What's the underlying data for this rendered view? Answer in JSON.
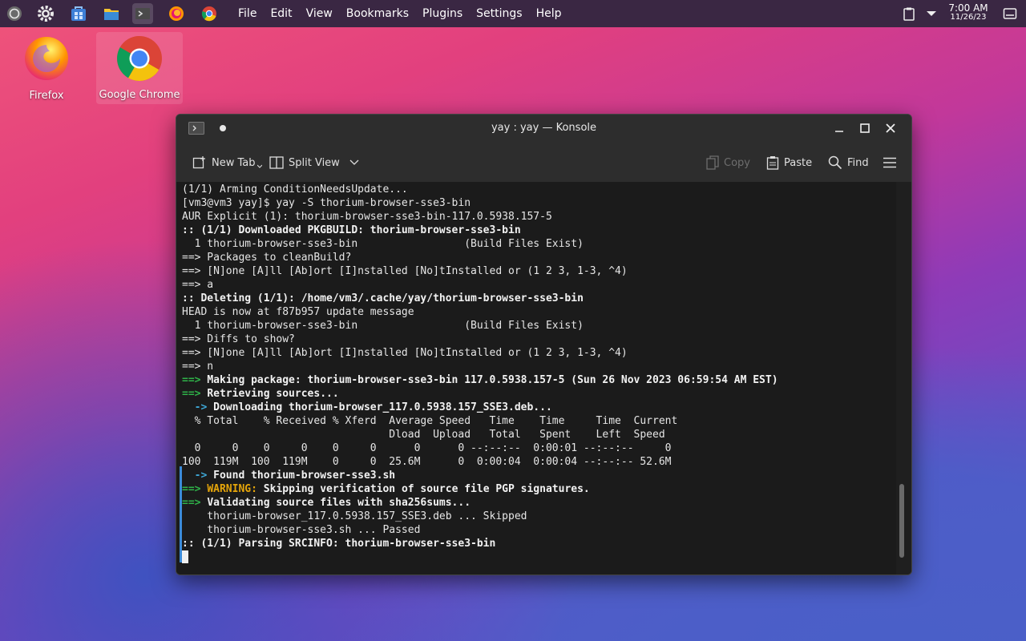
{
  "taskbar": {
    "menu": [
      "File",
      "Edit",
      "View",
      "Bookmarks",
      "Plugins",
      "Settings",
      "Help"
    ],
    "clock": {
      "time": "7:00 AM",
      "date": "11/26/23"
    }
  },
  "desktop": {
    "icons": [
      {
        "label": "Firefox"
      },
      {
        "label": "Google Chrome"
      }
    ]
  },
  "window": {
    "title": "yay : yay — Konsole",
    "toolbar": {
      "new_tab": "New Tab",
      "split_view": "Split View",
      "copy": "Copy",
      "paste": "Paste",
      "find": "Find"
    }
  },
  "terminal": {
    "lines": [
      {
        "segments": [
          {
            "text": "(1/1) Arming ConditionNeedsUpdate...",
            "style": ""
          }
        ]
      },
      {
        "segments": [
          {
            "text": "[vm3@vm3 yay]$ yay -S thorium-browser-sse3-bin",
            "style": ""
          }
        ]
      },
      {
        "segments": [
          {
            "text": "AUR Explicit (1): thorium-browser-sse3-bin-117.0.5938.157-5",
            "style": ""
          }
        ]
      },
      {
        "segments": [
          {
            "text": ":: (1/1) Downloaded PKGBUILD: thorium-browser-sse3-bin",
            "style": "b"
          }
        ]
      },
      {
        "segments": [
          {
            "text": "  1 thorium-browser-sse3-bin                 (Build Files Exist)",
            "style": ""
          }
        ]
      },
      {
        "segments": [
          {
            "text": "==> Packages to cleanBuild?",
            "style": ""
          }
        ]
      },
      {
        "segments": [
          {
            "text": "==> [N]one [A]ll [Ab]ort [I]nstalled [No]tInstalled or (1 2 3, 1-3, ^4)",
            "style": ""
          }
        ]
      },
      {
        "segments": [
          {
            "text": "==> a",
            "style": ""
          }
        ]
      },
      {
        "segments": [
          {
            "text": ":: Deleting (1/1): /home/vm3/.cache/yay/thorium-browser-sse3-bin",
            "style": "b"
          }
        ]
      },
      {
        "segments": [
          {
            "text": "HEAD is now at f87b957 update message",
            "style": ""
          }
        ]
      },
      {
        "segments": [
          {
            "text": "  1 thorium-browser-sse3-bin                 (Build Files Exist)",
            "style": ""
          }
        ]
      },
      {
        "segments": [
          {
            "text": "==> Diffs to show?",
            "style": ""
          }
        ]
      },
      {
        "segments": [
          {
            "text": "==> [N]one [A]ll [Ab]ort [I]nstalled [No]tInstalled or (1 2 3, 1-3, ^4)",
            "style": ""
          }
        ]
      },
      {
        "segments": [
          {
            "text": "==> n",
            "style": ""
          }
        ]
      },
      {
        "segments": [
          {
            "text": "==> ",
            "style": "g"
          },
          {
            "text": "Making package: thorium-browser-sse3-bin 117.0.5938.157-5 (Sun 26 Nov 2023 06:59:54 AM EST)",
            "style": "b"
          }
        ]
      },
      {
        "segments": [
          {
            "text": "==> ",
            "style": "g"
          },
          {
            "text": "Retrieving sources...",
            "style": "b"
          }
        ]
      },
      {
        "segments": [
          {
            "text": "  -> ",
            "style": "cyan"
          },
          {
            "text": "Downloading thorium-browser_117.0.5938.157_SSE3.deb...",
            "style": "b"
          }
        ]
      },
      {
        "segments": [
          {
            "text": "  % Total    % Received % Xferd  Average Speed   Time    Time     Time  Current",
            "style": ""
          }
        ]
      },
      {
        "segments": [
          {
            "text": "                                 Dload  Upload   Total   Spent    Left  Speed",
            "style": ""
          }
        ]
      },
      {
        "segments": [
          {
            "text": "  0     0    0     0    0     0      0      0 --:--:--  0:00:01 --:--:--     0",
            "style": ""
          }
        ]
      },
      {
        "segments": [
          {
            "text": "100  119M  100  119M    0     0  25.6M      0  0:00:04  0:00:04 --:--:-- 52.6M",
            "style": ""
          }
        ]
      },
      {
        "segments": [
          {
            "text": "  -> ",
            "style": "cyan"
          },
          {
            "text": "Found thorium-browser-sse3.sh",
            "style": "b"
          }
        ]
      },
      {
        "segments": [
          {
            "text": "==> ",
            "style": "g"
          },
          {
            "text": "WARNING: ",
            "style": "y"
          },
          {
            "text": "Skipping verification of source file PGP signatures.",
            "style": "b"
          }
        ]
      },
      {
        "segments": [
          {
            "text": "==> ",
            "style": "g"
          },
          {
            "text": "Validating source files with sha256sums...",
            "style": "b"
          }
        ]
      },
      {
        "segments": [
          {
            "text": "    thorium-browser_117.0.5938.157_SSE3.deb ... Skipped",
            "style": ""
          }
        ]
      },
      {
        "segments": [
          {
            "text": "    thorium-browser-sse3.sh ... Passed",
            "style": ""
          }
        ]
      },
      {
        "segments": [
          {
            "text": ":: (1/1) Parsing SRCINFO: thorium-browser-sse3-bin",
            "style": "b"
          }
        ]
      }
    ]
  },
  "colors": {
    "terminal_bg": "#1b1b1b",
    "arrow_green": "#2fb349",
    "warning_yellow": "#e5a50a",
    "arrow_cyan": "#3ea7d6",
    "taskbar_bg": "#3a2743"
  }
}
